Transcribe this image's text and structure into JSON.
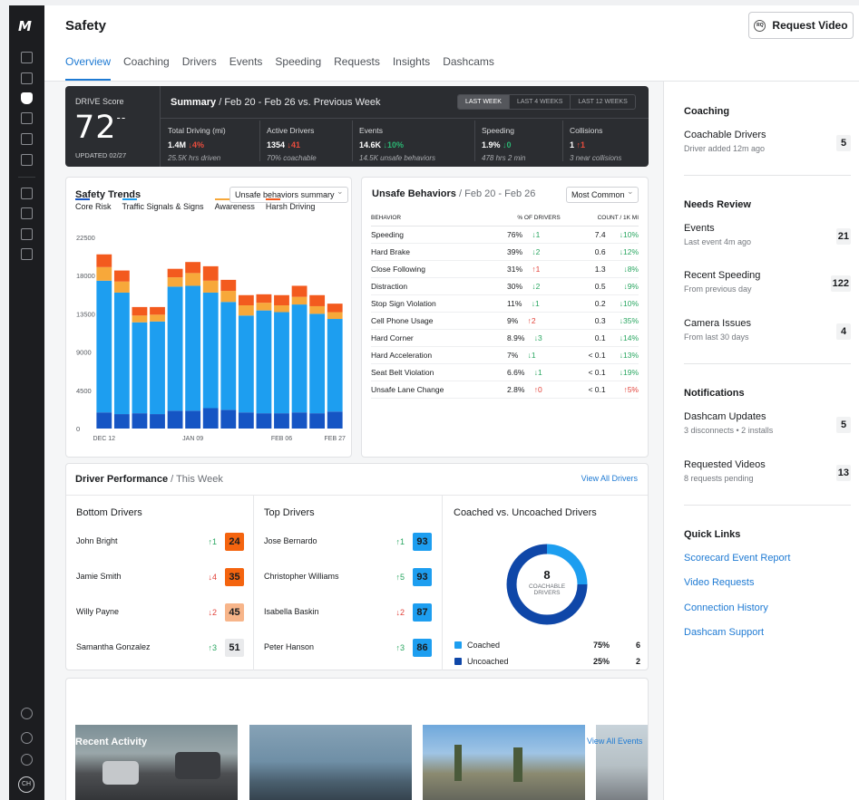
{
  "header": {
    "title": "Safety",
    "request_video": "Request Video",
    "request_icon": "RQ",
    "tabs": [
      {
        "label": "Overview",
        "active": true
      },
      {
        "label": "Coaching"
      },
      {
        "label": "Drivers"
      },
      {
        "label": "Events"
      },
      {
        "label": "Speeding"
      },
      {
        "label": "Requests"
      },
      {
        "label": "Insights"
      },
      {
        "label": "Dashcams"
      }
    ]
  },
  "sidebar": {
    "logo": "M",
    "avatar": "CH"
  },
  "drive_score": {
    "label": "DRIVE Score",
    "score": "72",
    "delta": "--",
    "updated": "UPDATED 02/27"
  },
  "summary": {
    "title": "Summary",
    "range": "/  Feb 20 - Feb 26 vs. Previous Week",
    "periods": [
      "LAST WEEK",
      "LAST 4 WEEKS",
      "LAST 12 WEEKS"
    ],
    "metrics": [
      {
        "label": "Total Driving (mi)",
        "value": "1.4M",
        "change": "↓4%",
        "sub": "25.5K hrs driven"
      },
      {
        "label": "Active Drivers",
        "value": "1354",
        "change": "↓41",
        "sub": "70% coachable"
      },
      {
        "label": "Events",
        "value": "14.6K",
        "change": "↓10%",
        "sub": "14.5K unsafe behaviors"
      },
      {
        "label": "Speeding",
        "value": "1.9%",
        "change": "↓0",
        "sub": "478 hrs 2 min"
      },
      {
        "label": "Collisions",
        "value": "1",
        "change": "↑1",
        "sub": "3 near collisions"
      }
    ]
  },
  "safety_trends": {
    "title": "Safety Trends",
    "dropdown": "Unsafe behaviors summary",
    "chart_data": {
      "type": "bar",
      "stacked": true,
      "categories": [
        "DEC 12",
        "",
        "",
        "",
        "",
        "JAN 09",
        "",
        "",
        "",
        "",
        "FEB 06",
        "",
        "",
        "FEB 27"
      ],
      "x_tick_labels": [
        "DEC 12",
        "JAN 09",
        "FEB 06",
        "FEB 27"
      ],
      "y_ticks": [
        "0",
        "4500",
        "9000",
        "13500",
        "18000",
        "22500"
      ],
      "ylim": [
        0,
        22500
      ],
      "series": [
        {
          "name": "Core Risk",
          "color": "#1555c4",
          "values": [
            1900,
            1700,
            1800,
            1700,
            2100,
            2100,
            2400,
            2200,
            1900,
            1800,
            1800,
            1900,
            1800,
            2000
          ]
        },
        {
          "name": "Traffic Signals & Signs",
          "color": "#1d9ef0",
          "values": [
            15500,
            14300,
            10700,
            10900,
            14600,
            14700,
            13600,
            12700,
            11400,
            12100,
            11900,
            12700,
            11700,
            10900
          ]
        },
        {
          "name": "Awareness",
          "color": "#f7a83a",
          "values": [
            1600,
            1300,
            800,
            800,
            1100,
            1500,
            1400,
            1300,
            1200,
            900,
            800,
            900,
            900,
            800
          ]
        },
        {
          "name": "Harsh Driving",
          "color": "#f35a1e",
          "values": [
            1500,
            1300,
            1000,
            900,
            1000,
            1300,
            1700,
            1300,
            1200,
            1000,
            1200,
            1300,
            1300,
            1000
          ]
        }
      ]
    }
  },
  "unsafe": {
    "title": "Unsafe Behaviors",
    "range": " / Feb 20 - Feb 26",
    "dropdown": "Most Common",
    "headers": [
      "BEHAVIOR",
      "% OF DRIVERS",
      "COUNT / 1K MI"
    ],
    "rows": [
      {
        "name": "Speeding",
        "pct": "76%",
        "pct_ch": "↓1",
        "pct_dir": "green",
        "count": "7.4",
        "count_ch": "↓10%",
        "count_dir": "green"
      },
      {
        "name": "Hard Brake",
        "pct": "39%",
        "pct_ch": "↓2",
        "pct_dir": "green",
        "count": "0.6",
        "count_ch": "↓12%",
        "count_dir": "green"
      },
      {
        "name": "Close Following",
        "pct": "31%",
        "pct_ch": "↑1",
        "pct_dir": "red",
        "count": "1.3",
        "count_ch": "↓8%",
        "count_dir": "green"
      },
      {
        "name": "Distraction",
        "pct": "30%",
        "pct_ch": "↓2",
        "pct_dir": "green",
        "count": "0.5",
        "count_ch": "↓9%",
        "count_dir": "green"
      },
      {
        "name": "Stop Sign Violation",
        "pct": "11%",
        "pct_ch": "↓1",
        "pct_dir": "green",
        "count": "0.2",
        "count_ch": "↓10%",
        "count_dir": "green"
      },
      {
        "name": "Cell Phone Usage",
        "pct": "9%",
        "pct_ch": "↑2",
        "pct_dir": "red",
        "count": "0.3",
        "count_ch": "↓35%",
        "count_dir": "green"
      },
      {
        "name": "Hard Corner",
        "pct": "8.9%",
        "pct_ch": "↓3",
        "pct_dir": "green",
        "count": "0.1",
        "count_ch": "↓14%",
        "count_dir": "green"
      },
      {
        "name": "Hard Acceleration",
        "pct": "7%",
        "pct_ch": "↓1",
        "pct_dir": "green",
        "count": "< 0.1",
        "count_ch": "↓13%",
        "count_dir": "green"
      },
      {
        "name": "Seat Belt Violation",
        "pct": "6.6%",
        "pct_ch": "↓1",
        "pct_dir": "green",
        "count": "< 0.1",
        "count_ch": "↓19%",
        "count_dir": "green"
      },
      {
        "name": "Unsafe Lane Change",
        "pct": "2.8%",
        "pct_ch": "↑0",
        "pct_dir": "red",
        "count": "< 0.1",
        "count_ch": "↑5%",
        "count_dir": "red"
      }
    ]
  },
  "driver_perf": {
    "title": "Driver Performance",
    "range": " / This Week",
    "view_all": "View All Drivers",
    "bottom_title": "Bottom Drivers",
    "bottom": [
      {
        "name": "John Bright",
        "change": "↑1",
        "dir": "green",
        "score": "24",
        "bg": "#f4640f",
        "fg": "#1a1c1f"
      },
      {
        "name": "Jamie Smith",
        "change": "↓4",
        "dir": "red",
        "score": "35",
        "bg": "#f4640f",
        "fg": "#1a1c1f"
      },
      {
        "name": "Willy Payne",
        "change": "↓2",
        "dir": "red",
        "score": "45",
        "bg": "#f7b58a",
        "fg": "#1a1c1f"
      },
      {
        "name": "Samantha Gonzalez",
        "change": "↑3",
        "dir": "green",
        "score": "51",
        "bg": "#e9eaec",
        "fg": "#1a1c1f"
      }
    ],
    "top_title": "Top Drivers",
    "top": [
      {
        "name": "Jose Bernardo",
        "change": "↑1",
        "dir": "green",
        "score": "93",
        "bg": "#1d9ef0",
        "fg": "#1a1c1f"
      },
      {
        "name": "Christopher Williams",
        "change": "↑5",
        "dir": "green",
        "score": "93",
        "bg": "#1d9ef0",
        "fg": "#1a1c1f"
      },
      {
        "name": "Isabella Baskin",
        "change": "↓2",
        "dir": "red",
        "score": "87",
        "bg": "#1d9ef0",
        "fg": "#1a1c1f"
      },
      {
        "name": "Peter Hanson",
        "change": "↑3",
        "dir": "green",
        "score": "86",
        "bg": "#1d9ef0",
        "fg": "#1a1c1f"
      }
    ],
    "coached_title": "Coached vs. Uncoached Drivers",
    "donut_value": "8",
    "donut_label_1": "COACHABLE",
    "donut_label_2": "DRIVERS",
    "coached": [
      {
        "label": "Coached",
        "pct": "75%",
        "count": "6",
        "color": "#1d9ef0",
        "fraction": 0.25
      },
      {
        "label": "Uncoached",
        "pct": "25%",
        "count": "2",
        "color": "#0f47a8",
        "fraction": 0.75
      }
    ]
  },
  "recent": {
    "title": "Recent Activity",
    "view_all": "View All Events"
  },
  "right_panel": {
    "coaching_title": "Coaching",
    "coaching": [
      {
        "title": "Coachable Drivers",
        "sub": "Driver added 12m ago",
        "count": "5"
      }
    ],
    "review_title": "Needs Review",
    "review": [
      {
        "title": "Events",
        "sub": "Last event 4m ago",
        "count": "21"
      },
      {
        "title": "Recent Speeding",
        "sub": "From previous day",
        "count": "122"
      },
      {
        "title": "Camera Issues",
        "sub": "From last 30 days",
        "count": "4"
      }
    ],
    "notif_title": "Notifications",
    "notifications": [
      {
        "title": "Dashcam Updates",
        "sub": "3 disconnects • 2 installs",
        "count": "5"
      },
      {
        "title": "Requested Videos",
        "sub": "8 requests pending",
        "count": "13"
      }
    ],
    "links_title": "Quick Links",
    "links": [
      "Scorecard Event Report",
      "Video Requests",
      "Connection History",
      "Dashcam Support"
    ]
  }
}
